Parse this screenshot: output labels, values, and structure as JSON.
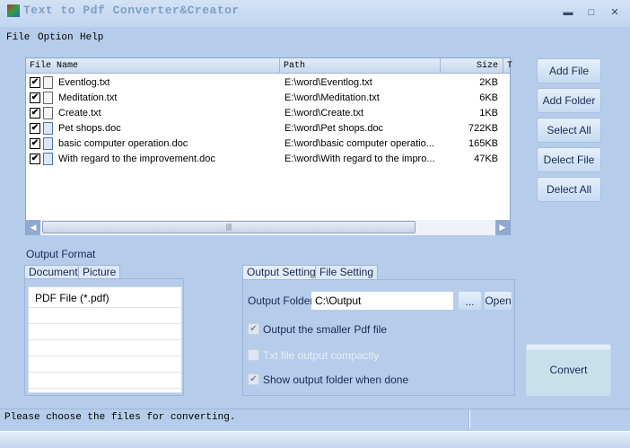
{
  "window": {
    "title": "Text to Pdf Converter&Creator",
    "minimize": "▬",
    "maximize": "□",
    "close": "✕"
  },
  "menu": [
    "File",
    "Option",
    "Help"
  ],
  "file_list": {
    "columns": [
      "File Name",
      "Path",
      "Size",
      "T"
    ],
    "rows": [
      {
        "checked": true,
        "type": "txt",
        "name": "Eventlog.txt",
        "path": "E:\\word\\Eventlog.txt",
        "size": "2KB"
      },
      {
        "checked": true,
        "type": "txt",
        "name": "Meditation.txt",
        "path": "E:\\word\\Meditation.txt",
        "size": "6KB"
      },
      {
        "checked": true,
        "type": "txt",
        "name": "Create.txt",
        "path": "E:\\word\\Create.txt",
        "size": "1KB"
      },
      {
        "checked": true,
        "type": "doc",
        "name": "Pet shops.doc",
        "path": "E:\\word\\Pet shops.doc",
        "size": "722KB"
      },
      {
        "checked": true,
        "type": "doc",
        "name": "basic computer operation.doc",
        "path": "E:\\word\\basic computer operatio...",
        "size": "165KB"
      },
      {
        "checked": true,
        "type": "doc",
        "name": "With regard to the improvement.doc",
        "path": "E:\\word\\With regard to the impro...",
        "size": "47KB"
      }
    ]
  },
  "side_buttons": [
    "Add File",
    "Add Folder",
    "Select All",
    "Delect File",
    "Delect All"
  ],
  "output_format": {
    "label": "Output Format",
    "tabs": [
      "Document",
      "Picture"
    ],
    "items": [
      "PDF File  (*.pdf)"
    ]
  },
  "output_settings": {
    "tabs": [
      "Output Setting",
      "File Setting"
    ],
    "folder_label": "Output Folder",
    "folder_value": "C:\\Output",
    "browse": "...",
    "open": "Open",
    "options": [
      {
        "label": "Output the smaller Pdf file",
        "checked": true,
        "enabled": true
      },
      {
        "label": "Txt file output compactly",
        "checked": false,
        "enabled": false
      },
      {
        "label": "Show output folder when done",
        "checked": true,
        "enabled": true
      }
    ]
  },
  "convert": "Convert",
  "status": "Please choose the files for converting."
}
